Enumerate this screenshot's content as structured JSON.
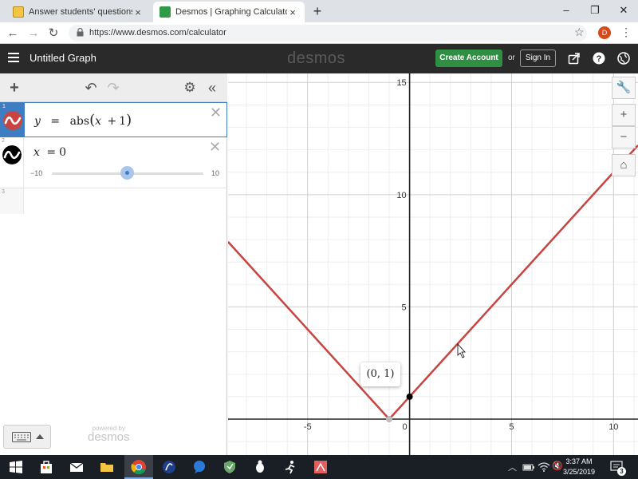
{
  "browser": {
    "tabs": [
      {
        "title": "Answer students' questions and f"
      },
      {
        "title": "Desmos | Graphing Calculator"
      }
    ],
    "url": "https://www.desmos.com/calculator",
    "profile_initial": "D"
  },
  "header": {
    "title": "Untitled Graph",
    "logo": "desmos",
    "create_account": "Create Account",
    "or": "or",
    "sign_in": "Sign In"
  },
  "expressions": [
    {
      "index": "1",
      "latex": "y = abs(x + 1)",
      "parts": {
        "y": "y",
        "eq": "=",
        "fn": "abs",
        "lp": "(",
        "x": "x",
        "plus": "+",
        "one": "1",
        "rp": ")"
      },
      "color": "#c74440"
    },
    {
      "index": "2",
      "lhs": "x",
      "eq": "=",
      "rhs": "0",
      "slider_min": "−10",
      "slider_max": "10",
      "color": "#000000"
    },
    {
      "index": "3"
    }
  ],
  "powered_by": {
    "line1": "powered by",
    "line2": "desmos"
  },
  "chart_data": {
    "type": "line",
    "title": "",
    "xlabel": "",
    "ylabel": "",
    "xlim": [
      -8.9,
      11.2
    ],
    "ylim": [
      -1.6,
      15.4
    ],
    "x_ticks": [
      -5,
      0,
      5,
      10
    ],
    "y_ticks": [
      5,
      10,
      15
    ],
    "grid": true,
    "series": [
      {
        "x": [
          -8.9,
          -1,
          11.2
        ],
        "y": [
          7.9,
          0,
          12.2
        ],
        "color": "#c74440"
      }
    ],
    "points": [
      {
        "x": 0,
        "y": 1,
        "color": "#000000"
      },
      {
        "x": -1,
        "y": 0,
        "color": "#bbbbbb"
      }
    ],
    "point_label": "(0, 1)"
  },
  "taskbar": {
    "time": "3:37 AM",
    "date": "3/25/2019",
    "notifications": "3"
  }
}
